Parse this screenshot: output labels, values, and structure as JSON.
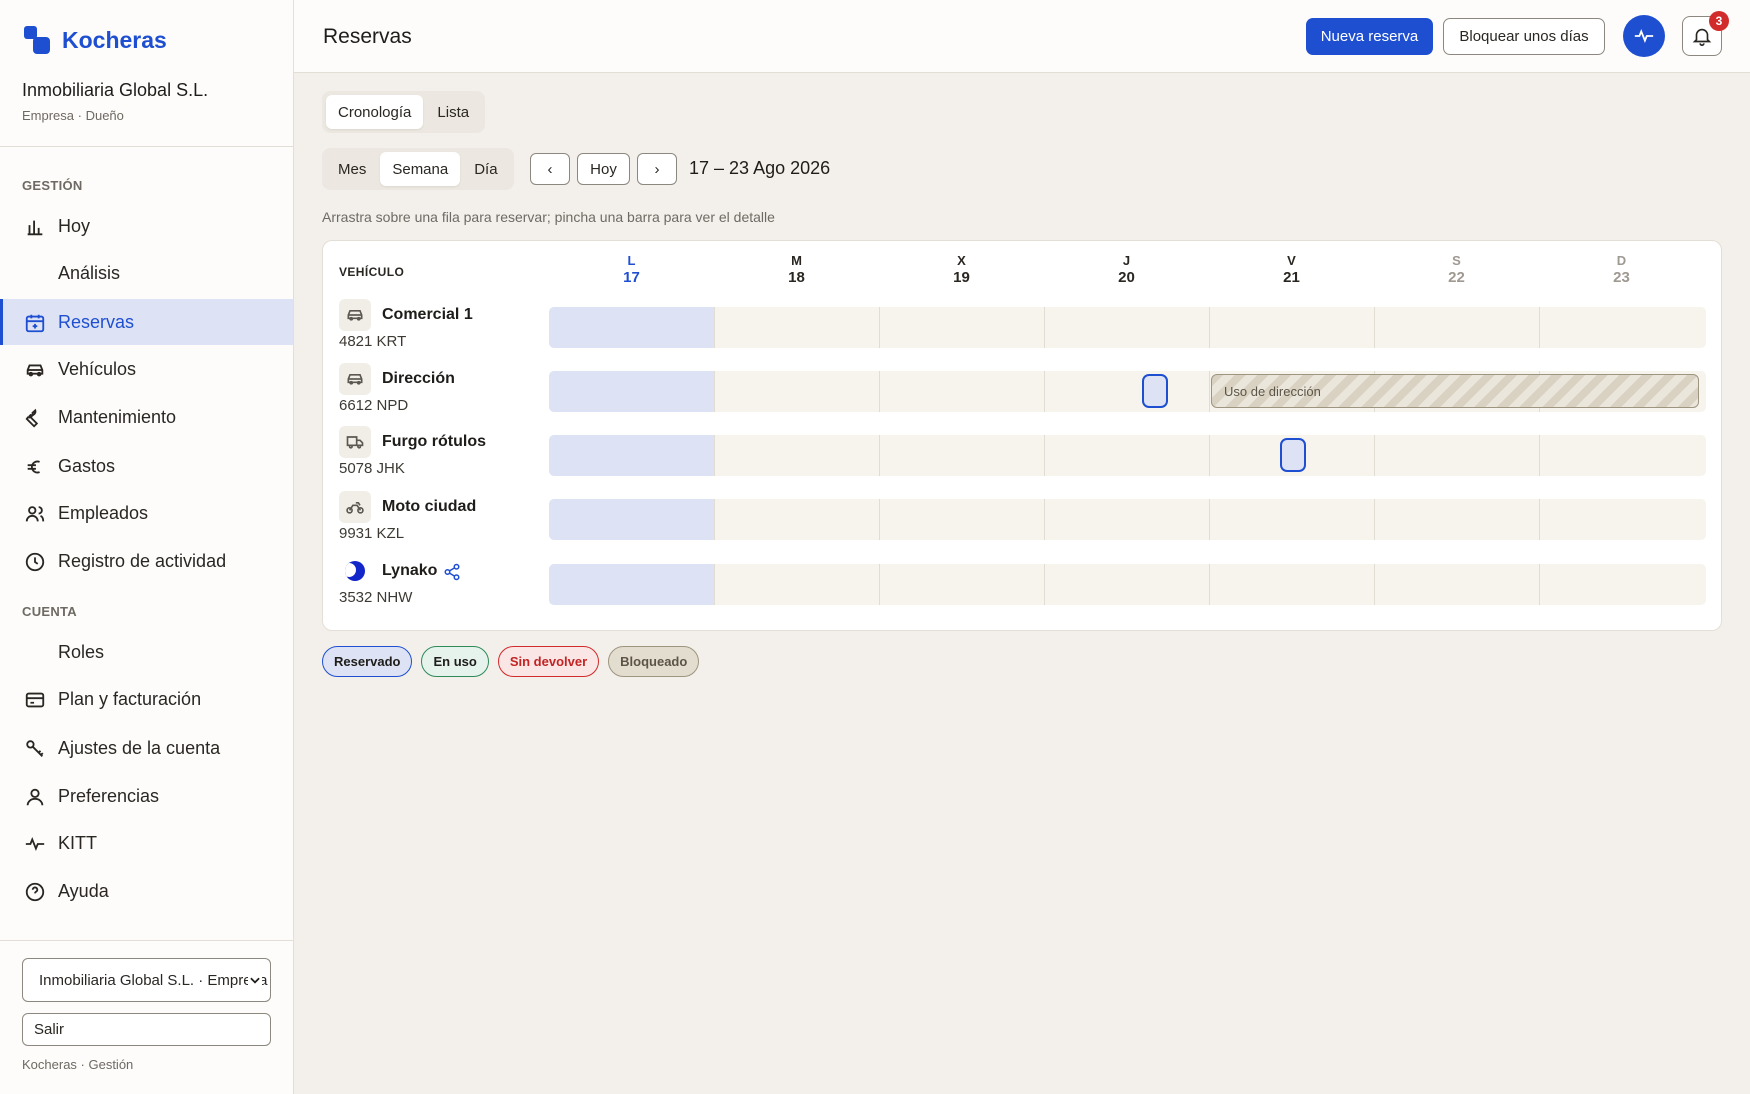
{
  "brand": {
    "name": "Kocheras"
  },
  "org": {
    "name": "Inmobiliaria Global S.L.",
    "role": "Empresa · Dueño"
  },
  "sidebar": {
    "section_gestion": "GESTIÓN",
    "section_cuenta": "CUENTA",
    "items": [
      {
        "label": "Hoy",
        "icon": "bar-chart-icon"
      },
      {
        "label": "Análisis",
        "icon": ""
      },
      {
        "label": "Reservas",
        "icon": "calendar-icon",
        "active": true
      },
      {
        "label": "Vehículos",
        "icon": "car-icon"
      },
      {
        "label": "Mantenimiento",
        "icon": "wrench-icon"
      },
      {
        "label": "Gastos",
        "icon": "euro-icon"
      },
      {
        "label": "Empleados",
        "icon": "users-icon"
      },
      {
        "label": "Registro de actividad",
        "icon": "clock-icon"
      },
      {
        "label": "Roles",
        "icon": ""
      },
      {
        "label": "Plan y facturación",
        "icon": "credit-card-icon"
      },
      {
        "label": "Ajustes de la cuenta",
        "icon": "key-icon"
      },
      {
        "label": "Preferencias",
        "icon": "user-icon"
      },
      {
        "label": "KITT",
        "icon": "pulse-icon"
      },
      {
        "label": "Ayuda",
        "icon": "help-icon"
      }
    ],
    "org_select_value": "Inmobiliaria Global S.L. · Empresa",
    "logout_label": "Salir",
    "footer": "Kocheras · Gestión"
  },
  "header": {
    "title": "Reservas",
    "new_booking_label": "Nueva reserva",
    "block_days_label": "Bloquear unos días",
    "notification_count": "3"
  },
  "view_tabs": [
    "Cronología",
    "Lista"
  ],
  "range_tabs": [
    "Mes",
    "Semana",
    "Día"
  ],
  "nav": {
    "prev": "‹",
    "today": "Hoy",
    "next": "›"
  },
  "range_label": "17 – 23 Ago 2026",
  "hint": "Arrastra sobre una fila para reservar; pincha una barra para ver el detalle",
  "calendar": {
    "vehicle_header": "VEHÍCULO",
    "days": [
      {
        "letter": "L",
        "num": "17",
        "state": "today"
      },
      {
        "letter": "M",
        "num": "18",
        "state": ""
      },
      {
        "letter": "X",
        "num": "19",
        "state": ""
      },
      {
        "letter": "J",
        "num": "20",
        "state": ""
      },
      {
        "letter": "V",
        "num": "21",
        "state": ""
      },
      {
        "letter": "S",
        "num": "22",
        "state": "weekend"
      },
      {
        "letter": "D",
        "num": "23",
        "state": "weekend"
      }
    ],
    "vehicles": [
      {
        "name": "Comercial 1",
        "plate": "4821 KRT",
        "icon": "car-icon"
      },
      {
        "name": "Dirección",
        "plate": "6612 NPD",
        "icon": "car-icon"
      },
      {
        "name": "Furgo rótulos",
        "plate": "5078 JHK",
        "icon": "truck-icon"
      },
      {
        "name": "Moto ciudad",
        "plate": "9931 KZL",
        "icon": "motorcycle-icon"
      },
      {
        "name": "Lynako",
        "plate": "3532 NHW",
        "icon": "lynako-logo",
        "shared": true
      }
    ],
    "blocked_label": "Uso de dirección"
  },
  "legend": [
    "Reservado",
    "En uso",
    "Sin devolver",
    "Bloqueado"
  ],
  "colors": {
    "accent": "#1f4fd1",
    "danger": "#d12b2b",
    "success": "#2f8a58"
  }
}
